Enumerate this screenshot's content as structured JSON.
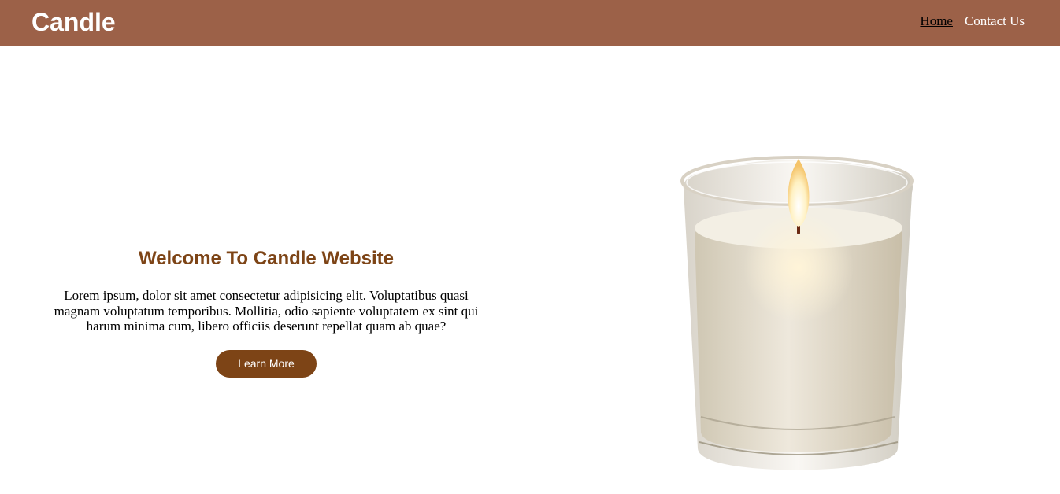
{
  "navbar": {
    "brand": "Candle",
    "links": [
      {
        "label": "Home",
        "active": true
      },
      {
        "label": "Contact Us",
        "active": false
      }
    ],
    "colors": {
      "background": "#9c6148",
      "text": "#ffffff",
      "active": "#000000"
    }
  },
  "hero": {
    "title": "Welcome To Candle Website",
    "description": "Lorem ipsum, dolor sit amet consectetur adipisicing elit. Voluptatibus quasi magnam voluptatum temporibus. Mollitia, odio sapiente voluptatem ex sint qui harum minima cum, libero officiis deserunt repellat quam ab quae?",
    "button_label": "Learn More",
    "accent_color": "#7d4416"
  },
  "image": {
    "icon": "candle-jar-image"
  }
}
